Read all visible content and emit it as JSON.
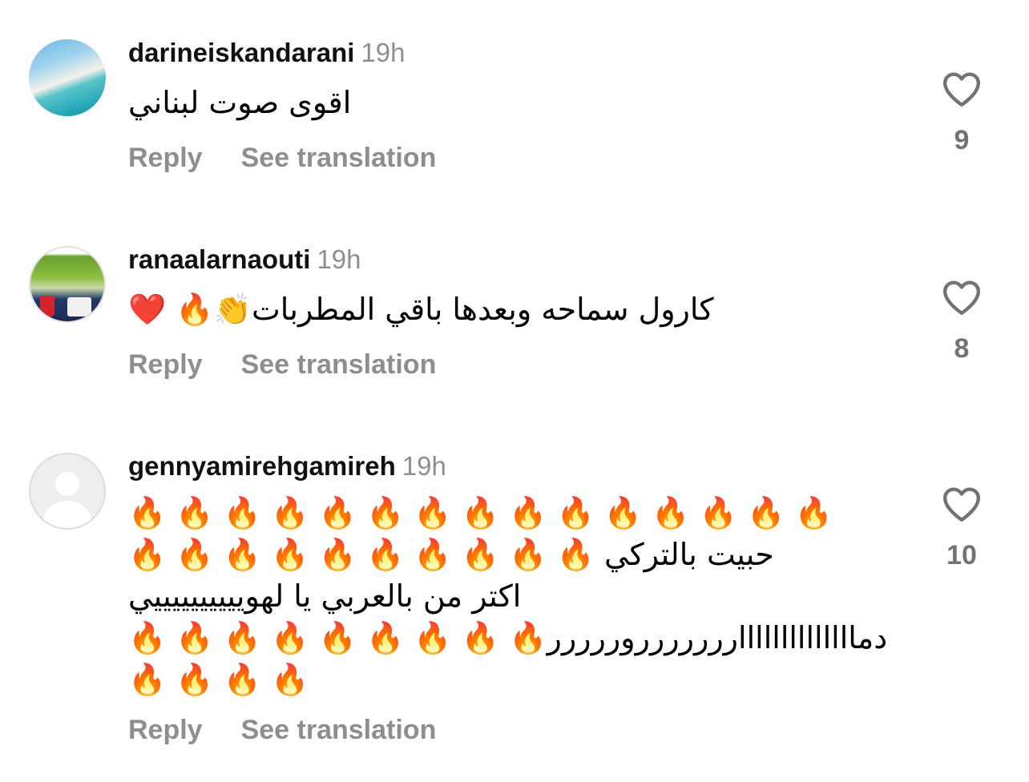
{
  "comments": [
    {
      "username": "darineiskandarani",
      "time": "19h",
      "lines": [
        "اقوى صوت لبناني"
      ],
      "reply_label": "Reply",
      "translate_label": "See translation",
      "likes": "9",
      "avatar_icon": "beach-avatar"
    },
    {
      "username": "ranaalarnaouti",
      "time": "19h",
      "lines": [
        "❤️ 🔥👏كارول سماحه وبعدها باقي المطربات"
      ],
      "reply_label": "Reply",
      "translate_label": "See translation",
      "likes": "8",
      "avatar_icon": "photo-avatar"
    },
    {
      "username": "gennyamirehgamireh",
      "time": "19h",
      "lines": [
        "🔥 🔥 🔥 🔥 🔥 🔥 🔥 🔥 🔥 🔥 🔥 🔥 🔥 🔥 🔥",
        "🔥 🔥 🔥 🔥 🔥 🔥 🔥 🔥 🔥 🔥 حبيت بالتركي",
        "اكتر من بالعربي يا لهوييييييييييي",
        "🔥 🔥 🔥 🔥 🔥 🔥 🔥 🔥 🔥دمااااااااااااااررررررروررررر",
        "🔥 🔥 🔥 🔥"
      ],
      "reply_label": "Reply",
      "translate_label": "See translation",
      "likes": "10",
      "avatar_icon": "default-user-avatar"
    }
  ],
  "icons": {
    "like": "heart-outline-icon"
  },
  "colors": {
    "secondary_text": "#8e8e8e",
    "like_count": "#737373"
  }
}
